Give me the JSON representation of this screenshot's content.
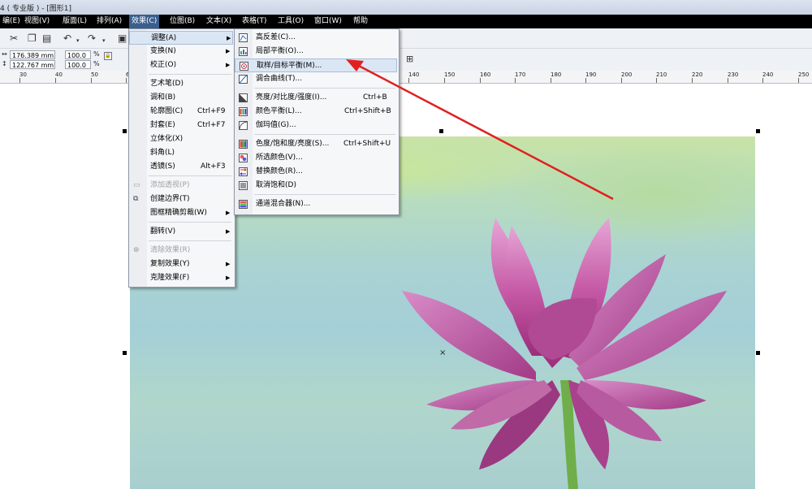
{
  "window": {
    "title": "4 ( 专业版 ) - [图形1]"
  },
  "menubar": {
    "items": [
      {
        "label": "编辑(E)",
        "display": "编(E)"
      },
      {
        "label": "视图(V)"
      },
      {
        "label": "版面(L)"
      },
      {
        "label": "排列(A)"
      },
      {
        "label": "效果(C)"
      },
      {
        "label": "位图(B)"
      },
      {
        "label": "文本(X)"
      },
      {
        "label": "表格(T)"
      },
      {
        "label": "工具(O)"
      },
      {
        "label": "窗口(W)"
      },
      {
        "label": "帮助"
      }
    ]
  },
  "toolbar": {
    "width_value": "176.389 mm",
    "height_value": "122.767 mm",
    "scale_x": "100.0",
    "scale_y": "100.0",
    "percent": "%"
  },
  "ruler": {
    "labels": [
      "30",
      "40",
      "50",
      "6",
      "140",
      "150",
      "160",
      "170",
      "180",
      "190",
      "200",
      "210",
      "220",
      "230",
      "240",
      "250"
    ]
  },
  "effects_menu": {
    "items": [
      {
        "label": "调整(A)",
        "has_submenu": true,
        "highlighted": true
      },
      {
        "label": "变换(N)",
        "has_submenu": true
      },
      {
        "label": "校正(O)",
        "has_submenu": true
      },
      {
        "label": "艺术笔(D)"
      },
      {
        "label": "调和(B)"
      },
      {
        "label": "轮廓图(C)",
        "shortcut": "Ctrl+F9"
      },
      {
        "label": "封套(E)",
        "shortcut": "Ctrl+F7"
      },
      {
        "label": "立体化(X)"
      },
      {
        "label": "斜角(L)"
      },
      {
        "label": "透镜(S)",
        "shortcut": "Alt+F3"
      },
      {
        "label": "添加透视(P)",
        "disabled": true
      },
      {
        "label": "创建边界(T)"
      },
      {
        "label": "图框精确剪裁(W)",
        "has_submenu": true
      },
      {
        "label": "翻转(V)",
        "has_submenu": true
      },
      {
        "label": "清除效果(R)",
        "disabled": true
      },
      {
        "label": "复制效果(Y)",
        "has_submenu": true
      },
      {
        "label": "克隆效果(F)",
        "has_submenu": true
      }
    ]
  },
  "adjust_submenu": {
    "items": [
      {
        "label": "高反差(C)...",
        "icon": "high-contrast-icon"
      },
      {
        "label": "局部平衡(O)...",
        "icon": "local-equalization-icon"
      },
      {
        "label": "取样/目标平衡(M)...",
        "icon": "sample-target-balance-icon",
        "highlighted": true
      },
      {
        "label": "调合曲线(T)...",
        "icon": "tone-curve-icon"
      },
      {
        "label": "亮度/对比度/强度(I)...",
        "shortcut": "Ctrl+B",
        "icon": "brightness-contrast-icon"
      },
      {
        "label": "颜色平衡(L)...",
        "shortcut": "Ctrl+Shift+B",
        "icon": "color-balance-icon"
      },
      {
        "label": "伽玛值(G)...",
        "icon": "gamma-icon"
      },
      {
        "label": "色度/饱和度/亮度(S)...",
        "shortcut": "Ctrl+Shift+U",
        "icon": "hue-saturation-icon"
      },
      {
        "label": "所选颜色(V)...",
        "icon": "selective-color-icon"
      },
      {
        "label": "替换颜色(R)...",
        "icon": "replace-color-icon"
      },
      {
        "label": "取消饱和(D)",
        "icon": "desaturate-icon"
      },
      {
        "label": "通道混合器(N)...",
        "icon": "channel-mixer-icon"
      }
    ]
  },
  "colors": {
    "menubar_bg": "#000000",
    "highlight": "#dbe6f4",
    "arrow": "#e02020"
  }
}
